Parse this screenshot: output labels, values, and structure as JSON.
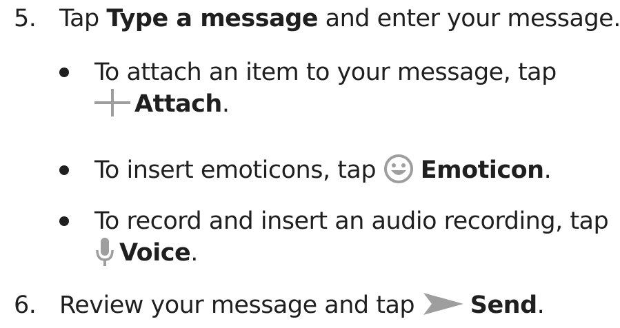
{
  "steps": [
    {
      "number": "5.",
      "text_before": "Tap ",
      "bold": "Type a message",
      "text_after": " and enter your message."
    },
    {
      "number": "6.",
      "text_before": "Review your message and tap ",
      "icon": "send-icon",
      "bold": "Send",
      "text_after": "."
    }
  ],
  "bullets": [
    {
      "line1": "To attach an item to your message, tap",
      "icon": "attach-plus-icon",
      "bold": "Attach",
      "text_after": "."
    },
    {
      "text_before": "To insert emoticons, tap ",
      "icon": "emoticon-icon",
      "bold": "Emoticon",
      "text_after": "."
    },
    {
      "line1": "To record and insert an audio recording, tap",
      "icon": "microphone-icon",
      "bold": "Voice",
      "text_after": "."
    }
  ],
  "colors": {
    "text": "#1f1f1f",
    "icon_gray": "#9e9e9e"
  }
}
